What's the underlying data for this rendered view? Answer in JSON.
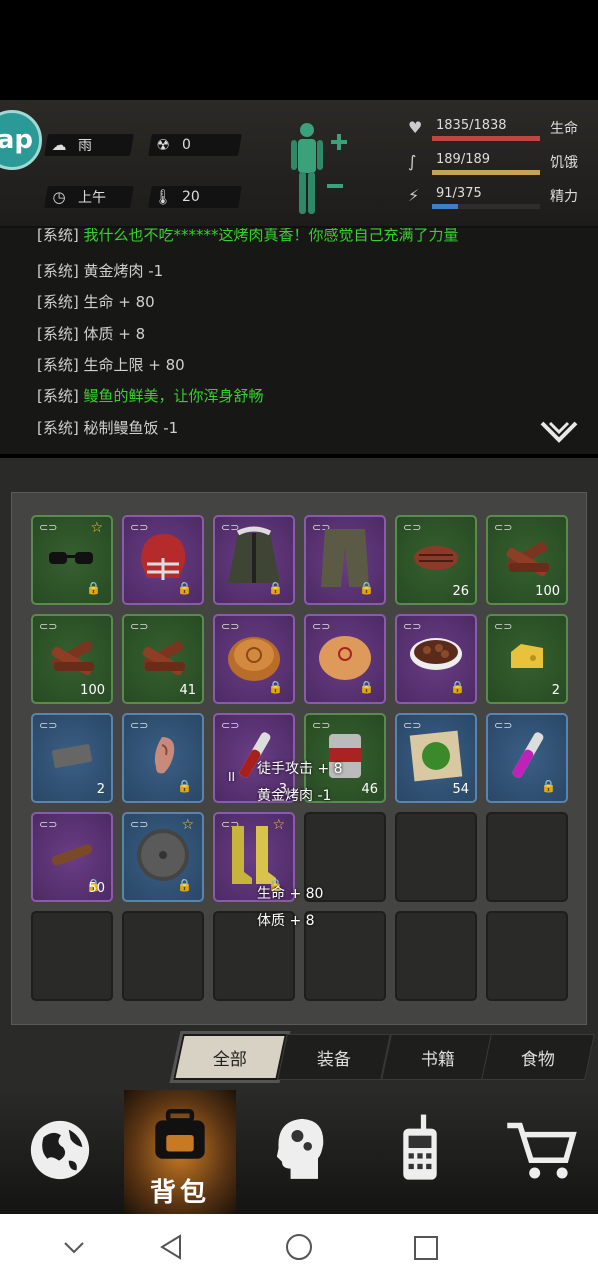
{
  "status": {
    "ap_label": "ap",
    "weather": "雨",
    "radiation": "0",
    "time_of_day": "上午",
    "temperature": "20",
    "health": {
      "value": "1835/1838",
      "label": "生命",
      "fraction": 0.998,
      "color": "#c0463f"
    },
    "hunger": {
      "value": "189/189",
      "label": "饥饿",
      "fraction": 1.0,
      "color": "#c8a257"
    },
    "energy": {
      "value": "91/375",
      "label": "精力",
      "fraction": 0.243,
      "color": "#3f7fc7"
    }
  },
  "log": {
    "lines": [
      {
        "prefix": "[系统]",
        "text": "我什么也不吃******这烤肉真香！你感觉自己充满了力量",
        "green": true
      },
      {
        "prefix": "[系统]",
        "text": "黄金烤肉 -1",
        "green": false
      },
      {
        "prefix": "[系统]",
        "text": "生命 + 80",
        "green": false
      },
      {
        "prefix": "[系统]",
        "text": "体质 + 8",
        "green": false
      },
      {
        "prefix": "[系统]",
        "text": "生命上限 + 80",
        "green": false
      },
      {
        "prefix": "[系统]",
        "text": "鳗鱼的鲜美，让你浑身舒畅",
        "green": true
      },
      {
        "prefix": "[系统]",
        "text": "秘制鳗鱼饭 -1",
        "green": false
      }
    ]
  },
  "inventory": {
    "slots": [
      {
        "name": "glasses",
        "rarity": "green",
        "star": true,
        "lock": true,
        "count": ""
      },
      {
        "name": "football-helmet",
        "rarity": "purple",
        "star": false,
        "lock": true,
        "count": ""
      },
      {
        "name": "winter-jacket",
        "rarity": "purple",
        "star": false,
        "lock": true,
        "count": ""
      },
      {
        "name": "cargo-shorts",
        "rarity": "purple",
        "star": false,
        "lock": true,
        "count": ""
      },
      {
        "name": "steak",
        "rarity": "green",
        "star": false,
        "lock": false,
        "count": "26"
      },
      {
        "name": "jerky",
        "rarity": "green",
        "star": false,
        "lock": false,
        "count": "100"
      },
      {
        "name": "jerky",
        "rarity": "green",
        "star": false,
        "lock": false,
        "count": "100"
      },
      {
        "name": "jerky",
        "rarity": "green",
        "star": false,
        "lock": false,
        "count": "41"
      },
      {
        "name": "mooncake",
        "rarity": "purple",
        "star": false,
        "lock": true,
        "count": ""
      },
      {
        "name": "bun",
        "rarity": "purple",
        "star": false,
        "lock": true,
        "count": ""
      },
      {
        "name": "stew-bowl",
        "rarity": "purple",
        "star": false,
        "lock": true,
        "count": ""
      },
      {
        "name": "cheese",
        "rarity": "green",
        "star": false,
        "lock": false,
        "count": "2"
      },
      {
        "name": "whetstone",
        "rarity": "blue",
        "star": false,
        "lock": false,
        "count": "2"
      },
      {
        "name": "ear",
        "rarity": "blue",
        "star": false,
        "lock": true,
        "count": ""
      },
      {
        "name": "blood-vial",
        "rarity": "purple",
        "star": false,
        "lock": false,
        "count": "3"
      },
      {
        "name": "canned-food",
        "rarity": "green",
        "star": false,
        "lock": false,
        "count": "46"
      },
      {
        "name": "herb-map",
        "rarity": "blue",
        "star": false,
        "lock": false,
        "count": "54"
      },
      {
        "name": "purple-vial",
        "rarity": "blue",
        "star": false,
        "lock": true,
        "count": ""
      },
      {
        "name": "cigar",
        "rarity": "purple",
        "star": false,
        "lock": true,
        "count": "50"
      },
      {
        "name": "round-shield",
        "rarity": "blue",
        "star": true,
        "lock": true,
        "count": ""
      },
      {
        "name": "yellow-boots",
        "rarity": "purple",
        "star": true,
        "lock": true,
        "count": ""
      }
    ],
    "roman_numeral": "II",
    "float_texts": [
      "徒手攻击 + 8",
      "黄金烤肉 -1",
      "生命 + 80",
      "体质 + 8"
    ]
  },
  "tabs": [
    "全部",
    "装备",
    "书籍",
    "食物"
  ],
  "active_tab": "全部",
  "nav": {
    "backpack_label": "背包"
  },
  "colors": {
    "log_green": "#37d12c",
    "active_nav": "#c77a23"
  }
}
